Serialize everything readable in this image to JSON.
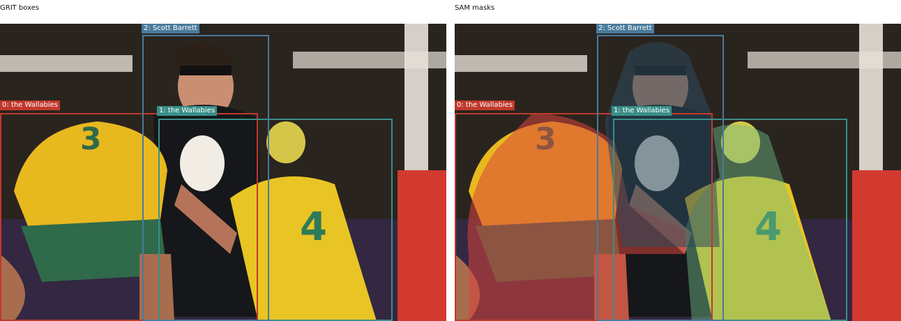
{
  "panels": [
    {
      "title": "GRIT boxes"
    },
    {
      "title": "SAM masks"
    }
  ],
  "detections": [
    {
      "id": 0,
      "label": "0: the Wallabies",
      "color": "#c0392b"
    },
    {
      "id": 1,
      "label": "1: the Wallabies",
      "color": "#3a8f88"
    },
    {
      "id": 2,
      "label": "2: Scott Barrett",
      "color": "#4a7a9c"
    }
  ],
  "sam_mask_colors": {
    "mask0": "#d9443a",
    "mask1": "#6fbf8a",
    "mask2": "#2b4a5e"
  }
}
